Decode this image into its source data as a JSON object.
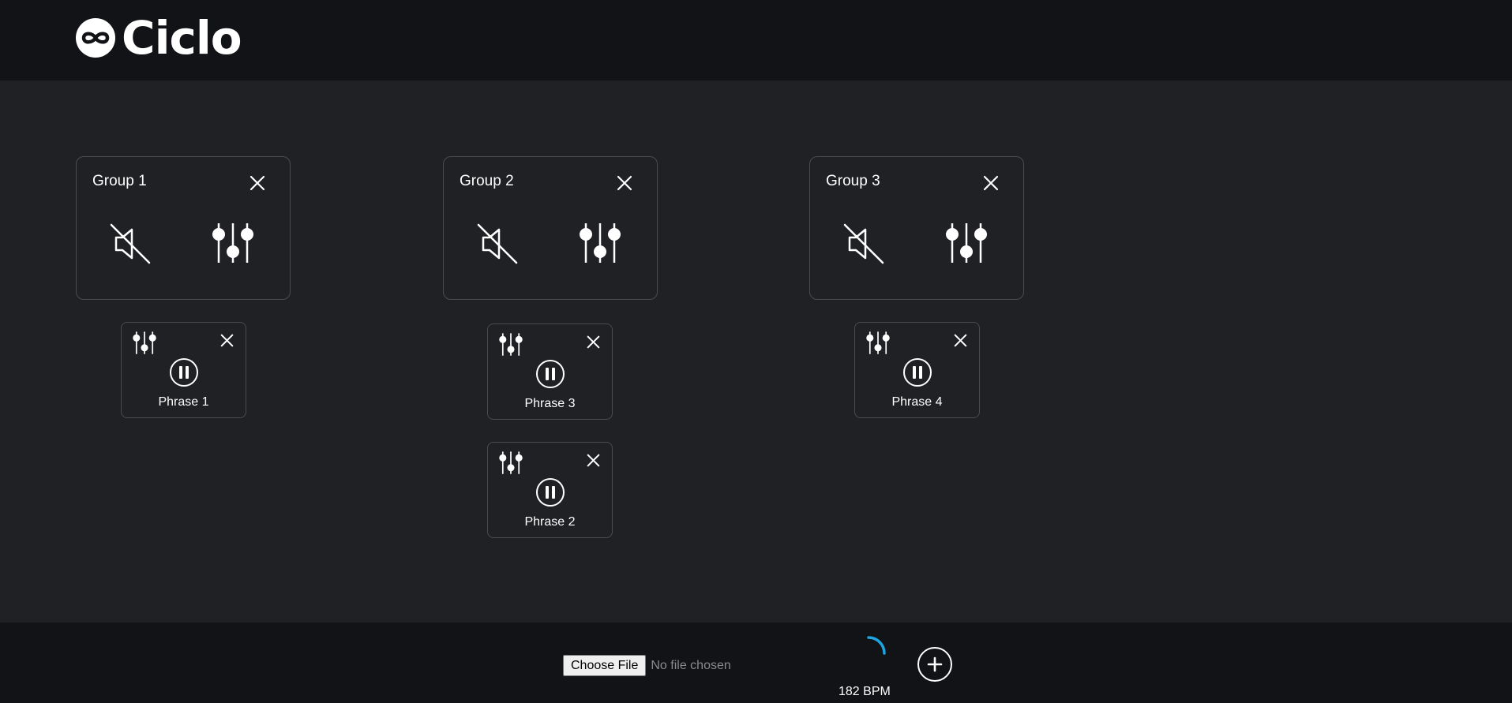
{
  "app": {
    "logo_text": "Ciclo",
    "logo_icon": "infinity-icon"
  },
  "groups": [
    {
      "title": "Group 1",
      "phrases": [
        {
          "label": "Phrase 1"
        }
      ]
    },
    {
      "title": "Group 2",
      "phrases": [
        {
          "label": "Phrase 3"
        },
        {
          "label": "Phrase 2"
        }
      ]
    },
    {
      "title": "Group 3",
      "phrases": [
        {
          "label": "Phrase 4"
        }
      ]
    }
  ],
  "icons": {
    "close": "close-icon",
    "mute": "speaker-muted-icon",
    "mixer": "sliders-icon",
    "pause": "pause-icon",
    "add": "plus-icon",
    "loading": "loading-spinner-icon"
  },
  "footer": {
    "file_button_label": "Choose File",
    "file_status": "No file chosen",
    "bpm": "182 BPM"
  },
  "colors": {
    "background": "#202125",
    "header_footer": "#121317",
    "card_border": "#4a4b50",
    "spinner_accent": "#1ea5e0"
  }
}
